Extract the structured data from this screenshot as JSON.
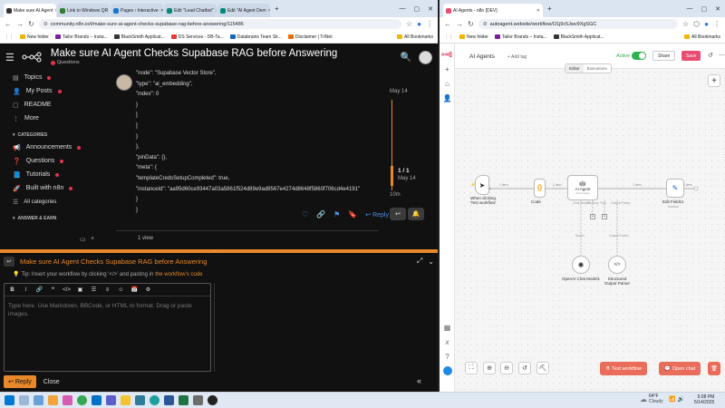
{
  "left_browser": {
    "tabs": [
      {
        "label": "Make sure AI Agent",
        "active": true,
        "color": "#ffffff"
      },
      {
        "label": "Link to Windows QR",
        "active": false,
        "color": "#2e7d32"
      },
      {
        "label": "Pages › Interactive",
        "active": false,
        "color": "#1976d2"
      },
      {
        "label": "Edit \"Lead Chatbot\"",
        "active": false,
        "color": "#00897b"
      },
      {
        "label": "Edit \"AI Agent Dem",
        "active": false,
        "color": "#00897b"
      }
    ],
    "url": "community.n8n.io/t/make-sure-ai-agent-checks-supabase-rag-before-answering/115486",
    "bookmarks": [
      "New folder",
      "Tailor Brands – Insta...",
      "BlackSmith Applicat...",
      "DS Services - DB-Ta...",
      "Databrains Team Sit...",
      "Disclaimer | TriNet"
    ],
    "all_bookmarks": "All Bookmarks"
  },
  "forum": {
    "title": "Make sure AI Agent Checks Supabase RAG before Answering",
    "category": "Questions",
    "sidebar": {
      "items": [
        "Topics",
        "My Posts",
        "README",
        "More"
      ],
      "categories_header": "CATEGORIES",
      "categories": [
        "Announcements",
        "Questions",
        "Tutorials",
        "Built with n8n",
        "All categories"
      ],
      "answer_header": "ANSWER & EARN"
    },
    "code_lines": [
      "\"node\": \"Supabase Vector Store\",",
      "\"type\": \"ai_embedding\",",
      "\"index\": 0",
      "}",
      "]",
      "]",
      "}",
      "},",
      "\"pinData\": {},",
      "\"meta\": {",
      "\"templateCredsSetupCompleted\": true,",
      "\"instanceId\": \"aa95d60ce93447a03a5861f524d89e9ad8567e4274d8648f5860f706cd4e4191\"",
      "}",
      "}"
    ],
    "timeline": {
      "top_date": "May 14",
      "position": "1 / 1",
      "bottom_date": "May 14",
      "ago": "10m"
    },
    "post_actions": {
      "reply": "Reply"
    },
    "views": "1 view"
  },
  "composer": {
    "title": "Make sure AI Agent Checks Supabase RAG before Answering",
    "tip_prefix": "Tip: Insert your workflow by clicking '</>' and pasting in ",
    "tip_link": "the workflow's code",
    "placeholder": "Type here. Use Markdown, BBCode, or HTML to format. Drag or paste images.",
    "reply": "Reply",
    "close": "Close"
  },
  "right_browser": {
    "tab": "AI Agents - n8n [DEV]",
    "url": "autoagent.website/workflow/O1j9c5Jwv9XgSGC",
    "bookmarks": [
      "New folder",
      "Tailor Brands – Insta...",
      "BlackSmith Applicat..."
    ],
    "all_bookmarks": "All Bookmarks"
  },
  "n8n": {
    "workflow_name": "AI Agents",
    "add_tag": "+ Add tag",
    "tabs": [
      "Editor",
      "Executions"
    ],
    "active_label": "Active",
    "share": "Share",
    "save": "Save",
    "nodes": {
      "trigger": "When clicking 'Test workflow'",
      "code": "Code",
      "agent": "AI Agent",
      "agent_sub": "Tools Agent",
      "edit": "Edit Fields1",
      "edit_sub": "manual",
      "openai": "OpenAI Chat Model1",
      "parser": "Structured Output Parser"
    },
    "edge_labels": {
      "e1": "1 item",
      "e2": "1 item",
      "e3": "1 item",
      "e4": "1 item",
      "e5": "1 item",
      "model": "Model",
      "output": "Output Parser"
    },
    "port_labels": {
      "chat": "Chat Model*",
      "memory": "Memory",
      "tool": "Tool",
      "parser": "Output Parser"
    },
    "test_workflow": "Test workflow",
    "open_chat": "Open chat"
  },
  "taskbar": {
    "weather_temp": "64°F",
    "weather_desc": "Cloudy",
    "time": "5:08 PM",
    "date": "5/14/2025"
  },
  "colors": {
    "accent_orange": "#e8882a",
    "n8n_red": "#ea4b71",
    "n8n_green": "#2bb24c",
    "link_blue": "#4a90e2"
  }
}
